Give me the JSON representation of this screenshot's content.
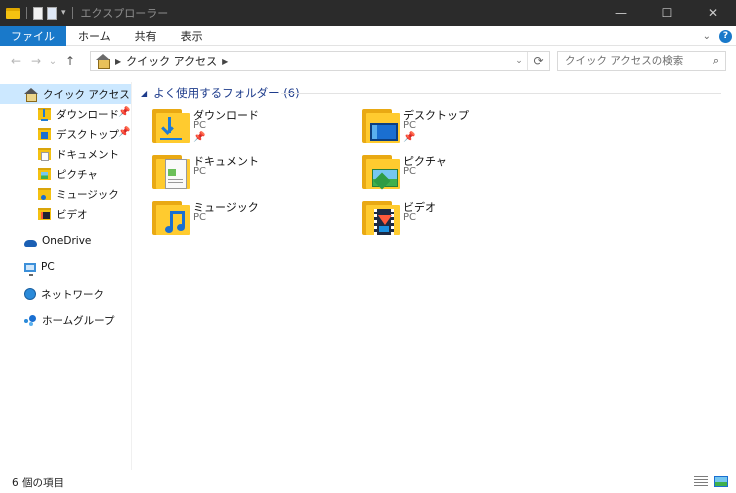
{
  "window": {
    "title": "エクスプローラー",
    "minimize": "—",
    "maximize": "☐",
    "close": "✕"
  },
  "ribbon": {
    "tabs": [
      "ファイル",
      "ホーム",
      "共有",
      "表示"
    ],
    "collapse_icon": "chevron-down-icon",
    "help": "?"
  },
  "nav": {
    "back": "←",
    "forward": "→",
    "recent": "⌄",
    "up": "↑",
    "breadcrumb": [
      "クイック アクセス"
    ],
    "refresh": "⟳",
    "search_placeholder": "クイック アクセスの検索"
  },
  "sidebar": {
    "quick_access": "クイック アクセス",
    "pinned": [
      {
        "label": "ダウンロード",
        "icon": "downloads-folder-icon",
        "pinned": true
      },
      {
        "label": "デスクトップ",
        "icon": "desktop-folder-icon",
        "pinned": true
      },
      {
        "label": "ドキュメント",
        "icon": "documents-folder-icon",
        "pinned": false
      },
      {
        "label": "ピクチャ",
        "icon": "pictures-folder-icon",
        "pinned": false
      },
      {
        "label": "ミュージック",
        "icon": "music-folder-icon",
        "pinned": false
      },
      {
        "label": "ビデオ",
        "icon": "videos-folder-icon",
        "pinned": false
      }
    ],
    "onedrive": "OneDrive",
    "pc": "PC",
    "network": "ネットワーク",
    "homegroup": "ホームグループ"
  },
  "content": {
    "group_title": "よく使用するフォルダー (6)",
    "folders": [
      {
        "name": "ダウンロード",
        "location": "PC",
        "pinned": true
      },
      {
        "name": "デスクトップ",
        "location": "PC",
        "pinned": true
      },
      {
        "name": "ドキュメント",
        "location": "PC",
        "pinned": false
      },
      {
        "name": "ピクチャ",
        "location": "PC",
        "pinned": false
      },
      {
        "name": "ミュージック",
        "location": "PC",
        "pinned": false
      },
      {
        "name": "ビデオ",
        "location": "PC",
        "pinned": false
      }
    ]
  },
  "status": {
    "item_count": "6 個の項目"
  },
  "colors": {
    "accent": "#1979ca",
    "titlebar": "#2b2b2b",
    "selection": "#cce8ff",
    "group_title": "#1e3c8c",
    "folder": "#ffcb2f"
  }
}
